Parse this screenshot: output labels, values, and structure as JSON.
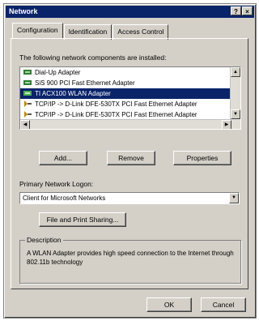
{
  "window": {
    "title": "Network",
    "help_btn": "?",
    "close_btn": "×"
  },
  "tabs": [
    {
      "label": "Configuration"
    },
    {
      "label": "Identification"
    },
    {
      "label": "Access Control"
    }
  ],
  "components": {
    "caption": "The following network components are installed:",
    "items": [
      {
        "label": "Dial-Up Adapter",
        "icon": "network-adapter-icon"
      },
      {
        "label": "SiS 900 PCI Fast Ethernet Adapter",
        "icon": "network-adapter-icon"
      },
      {
        "label": "TI ACX100 WLAN Adapter",
        "icon": "network-adapter-icon",
        "selected": true
      },
      {
        "label": "TCP/IP -> D-Link DFE-530TX PCI Fast Ethernet Adapter",
        "icon": "protocol-icon"
      },
      {
        "label": "TCP/IP -> D-Link DFE-530TX PCI Fast Ethernet Adapter",
        "icon": "protocol-icon"
      }
    ]
  },
  "buttons": {
    "add": "Add...",
    "remove": "Remove",
    "properties": "Properties",
    "file_print_sharing": "File and Print Sharing...",
    "ok": "OK",
    "cancel": "Cancel"
  },
  "logon": {
    "label": "Primary Network Logon:",
    "value": "Client for Microsoft Networks"
  },
  "description": {
    "title": "Description",
    "text": "A WLAN Adapter provides high speed connection to the Internet through 802.11b technology"
  },
  "colors": {
    "title_bar": "#0a246a",
    "selection": "#0a246a",
    "face": "#d4d0c8"
  }
}
